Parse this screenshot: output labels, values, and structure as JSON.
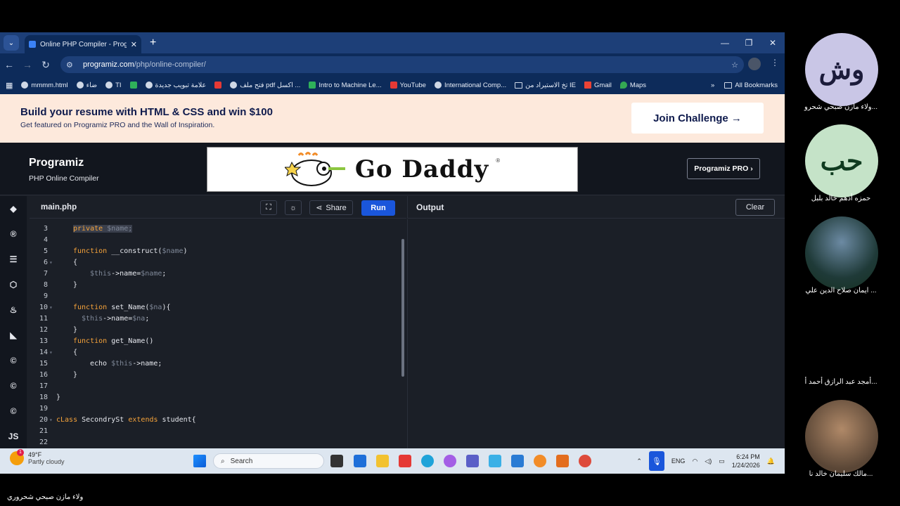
{
  "browser": {
    "tab_title": "Online PHP Compiler - Programiz",
    "url_host": "programiz.com",
    "url_path": "/php/online-compiler/",
    "bookmarks": [
      "mmmm.html",
      "ضاء",
      "TI",
      "علامة تبويب جديدة",
      "فتح ملف pdf اكسل ...",
      "Intro to Machine Le...",
      "YouTube",
      "International Comp...",
      "تخ الاستيراد من IE",
      "Gmail",
      "Maps"
    ],
    "all_bookmarks": "All Bookmarks"
  },
  "banner": {
    "headline": "Build your resume with HTML & CSS and win $100",
    "subline": "Get featured on Programiz PRO and the Wall of Inspiration.",
    "cta": "Join Challenge →"
  },
  "header": {
    "logo": "Programiz",
    "subtitle": "PHP Online Compiler",
    "ad_text": "Go Daddy",
    "ad_reg": "®",
    "pro_button": "Programiz PRO ›"
  },
  "editor": {
    "filename": "main.php",
    "share": "Share",
    "run": "Run",
    "lines": [
      {
        "n": "3",
        "fold": "",
        "indent": 2,
        "tokens": [
          {
            "t": "private ",
            "c": "kw hl"
          },
          {
            "t": "$name;",
            "c": "var hl"
          }
        ]
      },
      {
        "n": "4",
        "fold": "",
        "indent": 0,
        "tokens": []
      },
      {
        "n": "5",
        "fold": "",
        "indent": 2,
        "tokens": [
          {
            "t": "function ",
            "c": "kw"
          },
          {
            "t": "__construct(",
            "c": ""
          },
          {
            "t": "$name",
            "c": "var"
          },
          {
            "t": ")",
            "c": ""
          }
        ]
      },
      {
        "n": "6",
        "fold": "▾",
        "indent": 2,
        "tokens": [
          {
            "t": "{",
            "c": ""
          }
        ]
      },
      {
        "n": "7",
        "fold": "",
        "indent": 4,
        "tokens": [
          {
            "t": "$this",
            "c": "var"
          },
          {
            "t": "->name=",
            "c": ""
          },
          {
            "t": "$name",
            "c": "var"
          },
          {
            "t": ";",
            "c": ""
          }
        ]
      },
      {
        "n": "8",
        "fold": "",
        "indent": 2,
        "tokens": [
          {
            "t": "}",
            "c": ""
          }
        ]
      },
      {
        "n": "9",
        "fold": "",
        "indent": 0,
        "tokens": []
      },
      {
        "n": "10",
        "fold": "▾",
        "indent": 2,
        "tokens": [
          {
            "t": "function ",
            "c": "kw"
          },
          {
            "t": "set_Name(",
            "c": ""
          },
          {
            "t": "$na",
            "c": "var"
          },
          {
            "t": "){",
            "c": ""
          }
        ]
      },
      {
        "n": "11",
        "fold": "",
        "indent": 3,
        "tokens": [
          {
            "t": "$this",
            "c": "var"
          },
          {
            "t": "->name=",
            "c": ""
          },
          {
            "t": "$na",
            "c": "var"
          },
          {
            "t": ";",
            "c": ""
          }
        ]
      },
      {
        "n": "12",
        "fold": "",
        "indent": 2,
        "tokens": [
          {
            "t": "}",
            "c": ""
          }
        ]
      },
      {
        "n": "13",
        "fold": "",
        "indent": 2,
        "tokens": [
          {
            "t": "function ",
            "c": "kw"
          },
          {
            "t": "get_Name()",
            "c": ""
          }
        ]
      },
      {
        "n": "14",
        "fold": "▾",
        "indent": 2,
        "tokens": [
          {
            "t": "{",
            "c": ""
          }
        ]
      },
      {
        "n": "15",
        "fold": "",
        "indent": 4,
        "tokens": [
          {
            "t": "echo ",
            "c": ""
          },
          {
            "t": "$this",
            "c": "var"
          },
          {
            "t": "->name;",
            "c": ""
          }
        ]
      },
      {
        "n": "16",
        "fold": "",
        "indent": 2,
        "tokens": [
          {
            "t": "}",
            "c": ""
          }
        ]
      },
      {
        "n": "17",
        "fold": "",
        "indent": 0,
        "tokens": []
      },
      {
        "n": "18",
        "fold": "",
        "indent": 0,
        "tokens": [
          {
            "t": "}",
            "c": ""
          }
        ]
      },
      {
        "n": "19",
        "fold": "",
        "indent": 0,
        "tokens": []
      },
      {
        "n": "20",
        "fold": "▾",
        "indent": 0,
        "tokens": [
          {
            "t": "cLass ",
            "c": "kw"
          },
          {
            "t": "SecondrySt ",
            "c": ""
          },
          {
            "t": "extends ",
            "c": "kw"
          },
          {
            "t": "student{",
            "c": ""
          }
        ]
      },
      {
        "n": "21",
        "fold": "",
        "indent": 0,
        "tokens": []
      },
      {
        "n": "22",
        "fold": "",
        "indent": 0,
        "tokens": []
      }
    ]
  },
  "output": {
    "title": "Output",
    "clear": "Clear"
  },
  "rail_labels": [
    "JS"
  ],
  "taskbar": {
    "temp": "49°F",
    "condition": "Partly cloudy",
    "weather_badge": "1",
    "search_placeholder": "Search",
    "lang": "ENG",
    "time": "6:24 PM",
    "date": "1/24/2026"
  },
  "participants": [
    {
      "avatar_text": "وش",
      "name": "ولاء مازن صبحي شحرو...",
      "color": "#c9c6e6"
    },
    {
      "avatar_text": "حب",
      "name": "حمزه أدهم خالد بلبل",
      "color": "#c5e3c8"
    },
    {
      "avatar_text": "",
      "name": "ايمان صلاح الدين علي ...",
      "color": "#2d4a4a"
    },
    {
      "avatar_text": "",
      "name": "أمجد عبد الرازق أحمد أ...",
      "color": ""
    },
    {
      "avatar_text": "",
      "name": "مالك سليمان خالد نا...",
      "color": "#6b5a4a"
    }
  ],
  "footer_name": "ولاء مازن صبحي شحروري"
}
